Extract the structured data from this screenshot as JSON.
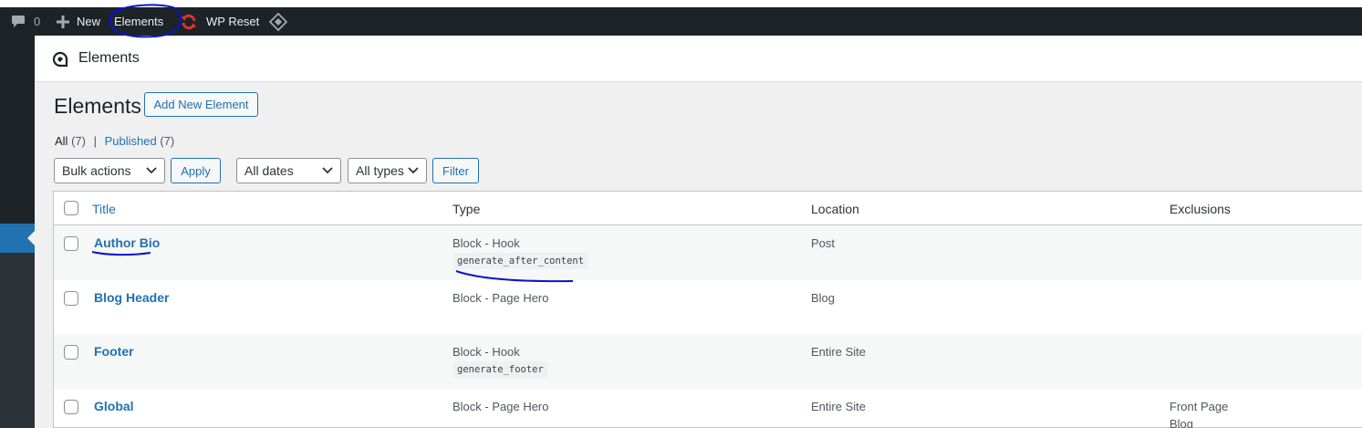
{
  "adminbar": {
    "comments_count": "0",
    "new_label": "New",
    "elements_label": "Elements",
    "wpreset_label": "WP Reset"
  },
  "header": {
    "title": "Elements"
  },
  "page": {
    "title": "Elements",
    "add_new_label": "Add New Element"
  },
  "views": {
    "all_label": "All",
    "all_count": "(7)",
    "separator": "|",
    "published_label": "Published",
    "published_count": "(7)"
  },
  "filters": {
    "bulk_actions": "Bulk actions",
    "apply_label": "Apply",
    "dates": "All dates",
    "types": "All types",
    "filter_label": "Filter"
  },
  "table": {
    "columns": [
      "Title",
      "Type",
      "Location",
      "Exclusions"
    ],
    "rows": [
      {
        "title": "Author Bio",
        "type": "Block - Hook",
        "hook": "generate_after_content",
        "location": "Post",
        "exclusions": [
          "",
          ""
        ]
      },
      {
        "title": "Blog Header",
        "type": "Block - Page Hero",
        "hook": "",
        "location": "Blog",
        "exclusions": [
          "",
          ""
        ]
      },
      {
        "title": "Footer",
        "type": "Block - Hook",
        "hook": "generate_footer",
        "location": "Entire Site",
        "exclusions": [
          "",
          ""
        ]
      },
      {
        "title": "Global",
        "type": "Block - Page Hero",
        "hook": "",
        "location": "Entire Site",
        "exclusions": [
          "Front Page",
          "Blog"
        ]
      }
    ]
  },
  "colors": {
    "adminbar": "#1d2327",
    "link": "#2271b1",
    "annotation": "#0a14c8"
  }
}
